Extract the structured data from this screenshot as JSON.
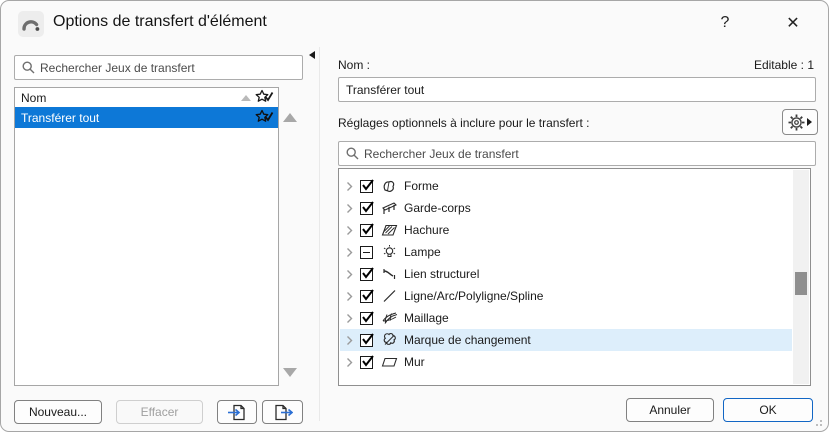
{
  "window": {
    "title": "Options de transfert d'élément",
    "help_label": "?",
    "close_label": "✕",
    "logo_icon": "archicad-logo-icon"
  },
  "left_panel": {
    "search": {
      "placeholder": "Rechercher Jeux de transfert",
      "icon": "search-icon"
    },
    "list": {
      "header": {
        "name_column": "Nom",
        "sort_icon": "sort-ascending-icon",
        "favorite_icon": "star-check-icon"
      },
      "rows": [
        {
          "label": "Transférer tout",
          "selected": true,
          "favorite_icon": "star-check-icon"
        }
      ]
    },
    "buttons": {
      "new_label": "Nouveau...",
      "delete_label": "Effacer",
      "import_icon": "import-icon",
      "export_icon": "export-icon"
    }
  },
  "right_panel": {
    "name_label": "Nom :",
    "editable_label": "Editable : 1",
    "name_value": "Transférer tout",
    "settings_label": "Réglages optionnels à inclure pour le transfert :",
    "settings_button_icon": "gear-flyout-icon",
    "search": {
      "placeholder": "Rechercher Jeux de transfert",
      "icon": "search-icon"
    },
    "tree": {
      "items": [
        {
          "label": "Forme",
          "state": "checked",
          "icon": "morph-icon",
          "highlighted": false
        },
        {
          "label": "Garde-corps",
          "state": "checked",
          "icon": "railing-icon",
          "highlighted": false
        },
        {
          "label": "Hachure",
          "state": "checked",
          "icon": "fill-icon",
          "highlighted": false
        },
        {
          "label": "Lampe",
          "state": "mixed",
          "icon": "lamp-icon",
          "highlighted": false
        },
        {
          "label": "Lien structurel",
          "state": "checked",
          "icon": "structural-link-icon",
          "highlighted": false
        },
        {
          "label": "Ligne/Arc/Polyligne/Spline",
          "state": "checked",
          "icon": "line-icon",
          "highlighted": false
        },
        {
          "label": "Maillage",
          "state": "checked",
          "icon": "mesh-icon",
          "highlighted": false
        },
        {
          "label": "Marque de changement",
          "state": "checked",
          "icon": "change-marker-icon",
          "highlighted": true
        },
        {
          "label": "Mur",
          "state": "checked",
          "icon": "wall-icon",
          "highlighted": false
        }
      ]
    },
    "buttons": {
      "cancel_label": "Annuler",
      "ok_label": "OK"
    }
  },
  "colors": {
    "selection_blue": "#0d78d7",
    "row_highlight": "#ddeefb",
    "accent_blue": "#2b6fd4",
    "default_button_border": "#1266c4"
  }
}
